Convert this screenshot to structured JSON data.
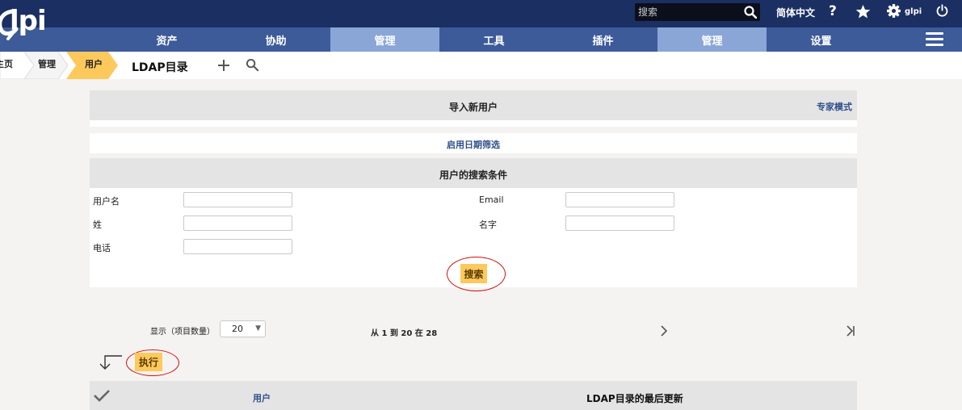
{
  "app": {
    "logo_text": "lpi"
  },
  "topbar": {
    "search_placeholder": "搜索",
    "language": "简体中文",
    "help": "?",
    "username": "glpi"
  },
  "menu": [
    {
      "label": "资产",
      "active": false
    },
    {
      "label": "协助",
      "active": false
    },
    {
      "label": "管理",
      "active": true
    },
    {
      "label": "工具",
      "active": false
    },
    {
      "label": "插件",
      "active": false
    },
    {
      "label": "管理",
      "active": true
    },
    {
      "label": "设置",
      "active": false
    }
  ],
  "breadcrumb": {
    "items": [
      "主页",
      "管理",
      "用户"
    ],
    "page_title": "LDAP目录"
  },
  "import": {
    "title": "导入新用户",
    "expert_mode": "专家模式",
    "date_filter_link": "启用日期筛选",
    "criteria_title": "用户的搜索条件",
    "fields": {
      "username": {
        "label": "用户名",
        "value": ""
      },
      "email": {
        "label": "Email",
        "value": ""
      },
      "surname": {
        "label": "姓",
        "value": ""
      },
      "firstname": {
        "label": "名字",
        "value": ""
      },
      "phone": {
        "label": "电话",
        "value": ""
      }
    },
    "search_button": "搜索"
  },
  "pager": {
    "display_label": "显示（项目数量）",
    "per_page": "20",
    "range": "从 1 到 20 在 28"
  },
  "results": {
    "execute_button": "执行",
    "col_user": "用户",
    "col_last_update": "LDAP目录的最后更新"
  },
  "colors": {
    "topbar": "#1b2f62",
    "menubar": "#3d5a99",
    "menu_active": "#8aa6d6",
    "accent_yellow": "#fec95c",
    "link": "#2f4f8a",
    "highlight_ring": "#d01010"
  }
}
